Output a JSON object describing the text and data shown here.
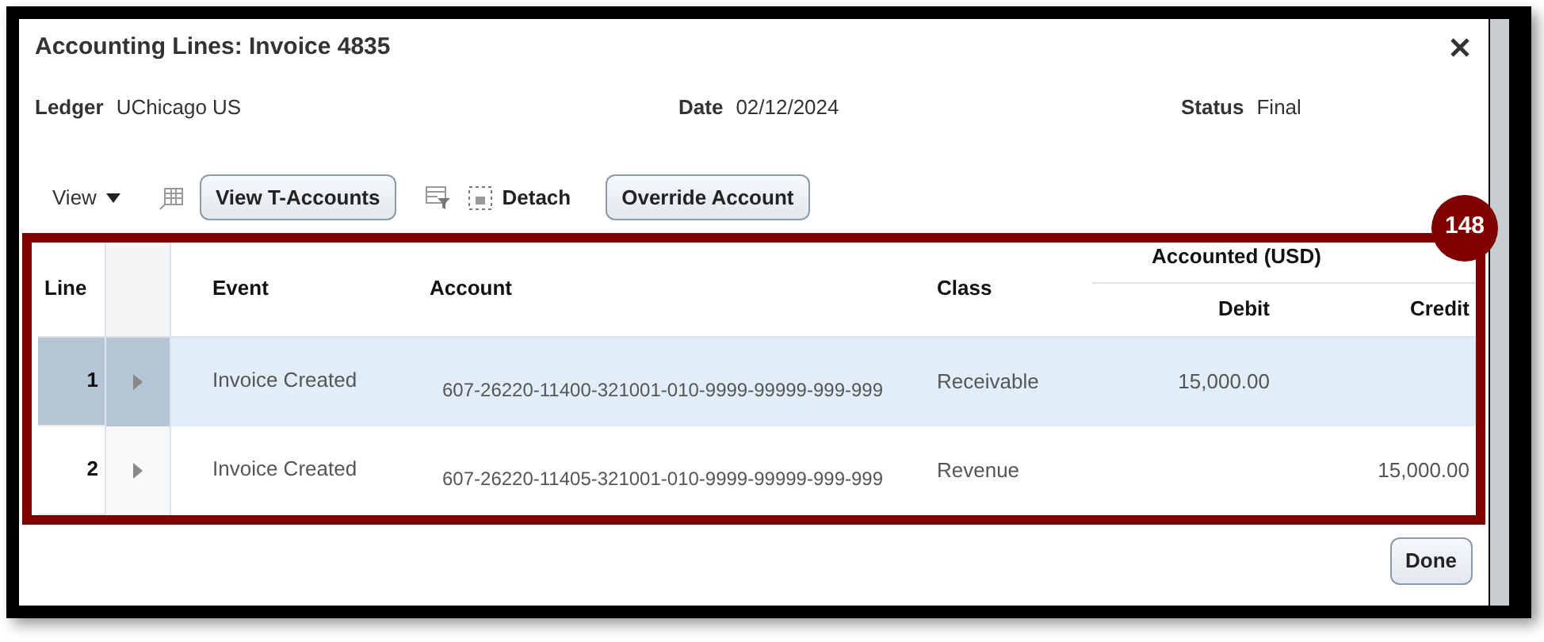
{
  "dialog": {
    "title": "Accounting Lines: Invoice 4835"
  },
  "header_fields": [
    {
      "label": "Ledger",
      "value": "UChicago US"
    },
    {
      "label": "Date",
      "value": "02/12/2024"
    },
    {
      "label": "Status",
      "value": "Final"
    }
  ],
  "toolbar": {
    "view_menu": "View",
    "view_t_accounts": "View T-Accounts",
    "detach": "Detach",
    "override_account": "Override Account"
  },
  "callout_badge": "148",
  "table": {
    "columns": [
      "Line",
      "Event",
      "Account",
      "Class"
    ],
    "group_header": "Accounted (USD)",
    "sub_columns": [
      "Debit",
      "Credit"
    ],
    "rows": [
      {
        "line": "1",
        "event": "Invoice Created",
        "account": "607-26220-11400-321001-010-9999-99999-999-999",
        "class": "Receivable",
        "debit": "15,000.00",
        "credit": "",
        "selected": true
      },
      {
        "line": "2",
        "event": "Invoice Created",
        "account": "607-26220-11405-321001-010-9999-99999-999-999",
        "class": "Revenue",
        "debit": "",
        "credit": "15,000.00",
        "selected": false
      }
    ]
  },
  "done_button": "Done"
}
